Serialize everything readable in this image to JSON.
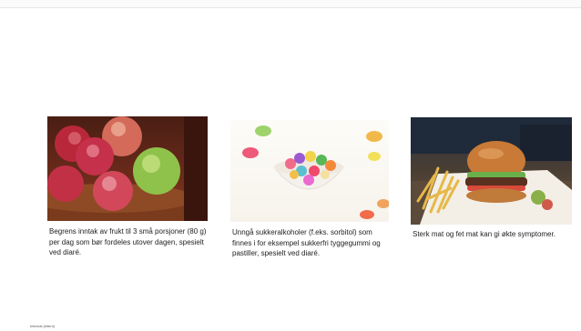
{
  "slide": {
    "cards": [
      {
        "image_label": "apples-in-bowl",
        "caption": "Begrens inntak av frukt til 3 små porsjoner (80 g) per dag som bør fordeles utover dagen, spesielt ved diaré."
      },
      {
        "image_label": "candy-bowl",
        "caption": "Unngå sukkeralkoholer (f.eks. sorbitol) som finnes i for eksempel sukkerfri tyggegummi og pastiller, spesielt ved diaré."
      },
      {
        "image_label": "burger-and-fries",
        "caption": "Sterk mat og fet mat kan gi økte symptomer."
      }
    ],
    "footer": "Internal (intern)"
  },
  "colors": {
    "background": "#ffffff",
    "text": "#222222"
  }
}
